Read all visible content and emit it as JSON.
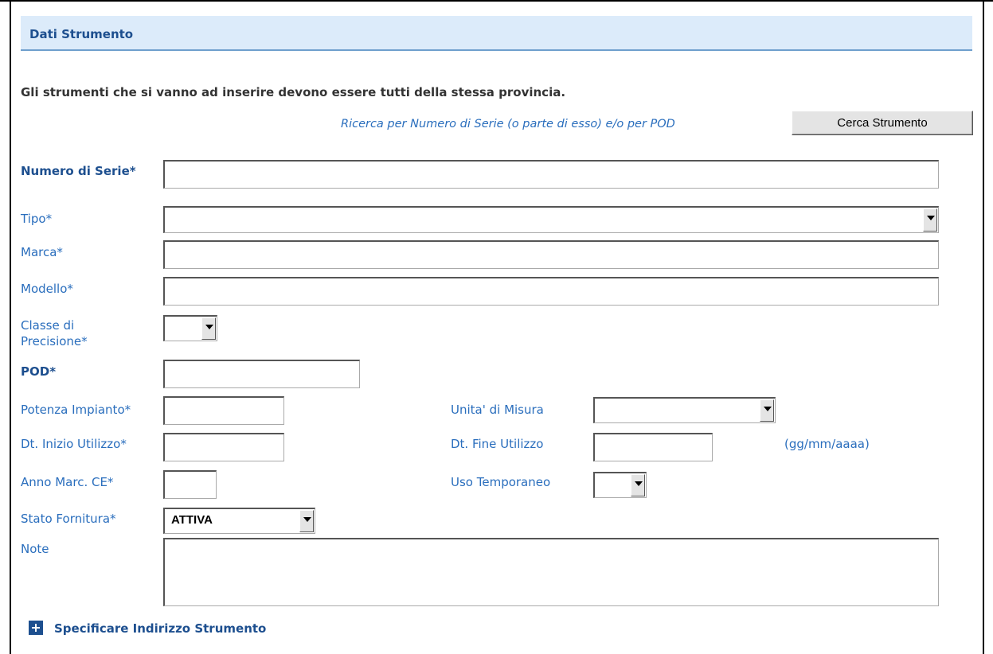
{
  "section": {
    "title": "Dati Strumento"
  },
  "notice": "Gli strumenti che si vanno ad inserire devono essere tutti della stessa provincia.",
  "search": {
    "hint": "Ricerca per Numero di Serie (o parte di esso) e/o per POD",
    "button_label": "Cerca Strumento"
  },
  "fields": {
    "numero_serie": {
      "label": "Numero di Serie*",
      "value": ""
    },
    "tipo": {
      "label": "Tipo*",
      "selected": ""
    },
    "marca": {
      "label": "Marca*",
      "value": ""
    },
    "modello": {
      "label": "Modello*",
      "value": ""
    },
    "classe_precisione": {
      "label": "Classe di Precisione*",
      "selected": ""
    },
    "pod": {
      "label": "POD*",
      "value": ""
    },
    "potenza_impianto": {
      "label": "Potenza Impianto*",
      "value": ""
    },
    "unita_misura": {
      "label": "Unita' di Misura",
      "selected": ""
    },
    "dt_inizio": {
      "label": "Dt. Inizio Utilizzo*",
      "value": ""
    },
    "dt_fine": {
      "label": "Dt. Fine Utilizzo",
      "value": ""
    },
    "date_format": "(gg/mm/aaaa)",
    "anno_marc_ce": {
      "label": "Anno Marc. CE*",
      "value": ""
    },
    "uso_temporaneo": {
      "label": "Uso Temporaneo",
      "selected": ""
    },
    "stato_fornitura": {
      "label": "Stato Fornitura*",
      "selected": "ATTIVA"
    },
    "note": {
      "label": "Note",
      "value": ""
    }
  },
  "address_toggle": {
    "label": "Specificare Indirizzo Strumento",
    "icon": "plus-icon"
  },
  "colors": {
    "header_bg": "#dcebfa",
    "accent": "#1d4f8f",
    "label": "#2a6ebd"
  }
}
